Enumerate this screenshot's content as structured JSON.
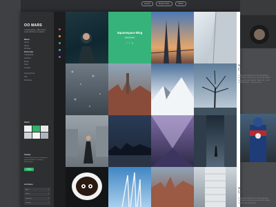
{
  "top_tags": [
    "Layout",
    "Responsive",
    "Clean"
  ],
  "sidebar": {
    "logo": "OO MARS",
    "tagline": "A Squarespace + Mars theme made with Haus on website",
    "menu_title": "Menu",
    "menu": [
      "Home",
      "About",
      "Wordlite",
      "Shortcodes",
      "Typography",
      "Archives",
      "Music",
      "Team",
      "Contact",
      "Coming Soon",
      "404",
      "Purchase"
    ],
    "active_index": 3,
    "flickr_title": "Flickr",
    "twitter_title": "Twitter",
    "twitter_text": "Lovely clean themes and gorgeous typography Mars is ready on Squarespace",
    "follow_label": "Follow",
    "archives_title": "Archives",
    "archives": [
      {
        "month": "April",
        "count": "3"
      },
      {
        "month": "March",
        "count": "5"
      },
      {
        "month": "February",
        "count": "2"
      },
      {
        "month": "January",
        "count": "7"
      }
    ]
  },
  "blog_tile": {
    "title": "Squarespace Blog",
    "subtitle": "Mars Theme",
    "social": [
      "f",
      "t",
      "g"
    ]
  },
  "right_column": [
    {
      "title": "at Squarespace Commerce customers.",
      "body": "Today we introduced a fully integrated commerce experience, as well as added features for merchants. Take with – with extended files – you can now."
    },
    {
      "title": "at Squarespace Commerce customers.",
      "body": "Today we introduced a fully integrated commerce experience, as well as added features for merchants."
    }
  ],
  "colors": {
    "accent_green": "#36b37a",
    "sidebar_bg": "#2d2f31",
    "dots": [
      "#e04b5a",
      "#f0a33a",
      "#36b37a",
      "#3aa6e0",
      "#8e5bd8"
    ]
  }
}
